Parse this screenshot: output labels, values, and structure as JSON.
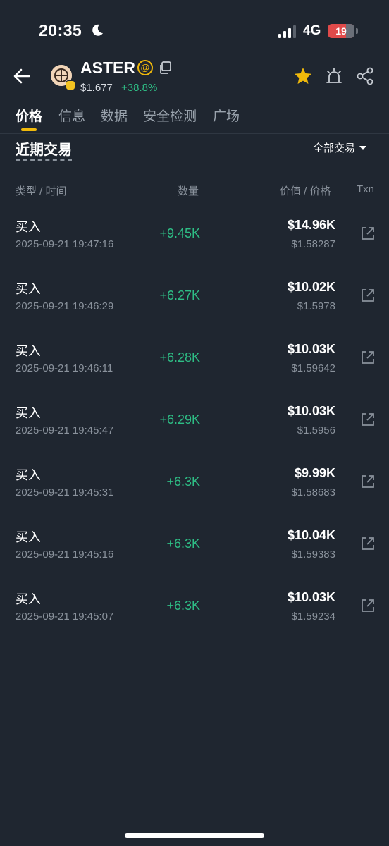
{
  "status_bar": {
    "time": "20:35",
    "network": "4G",
    "battery": "19"
  },
  "header": {
    "token_name": "ASTER",
    "price": "$1.677",
    "change": "+38.8%",
    "icons": [
      "back-icon",
      "at-icon",
      "copy-icon",
      "star-icon",
      "alert-icon",
      "share-icon"
    ],
    "at_symbol": "@"
  },
  "tabs": [
    {
      "label": "价格",
      "active": true
    },
    {
      "label": "信息"
    },
    {
      "label": "数据"
    },
    {
      "label": "安全检测"
    },
    {
      "label": "广场"
    }
  ],
  "section": {
    "title": "近期交易",
    "filter": "全部交易"
  },
  "columns": {
    "type_time": "类型 / 时间",
    "quantity": "数量",
    "value_price": "价值 / 价格",
    "txn": "Txn"
  },
  "trades": [
    {
      "type": "买入",
      "time": "2025-09-21 19:47:16",
      "quantity": "+9.45K",
      "value": "$14.96K",
      "price": "$1.58287"
    },
    {
      "type": "买入",
      "time": "2025-09-21 19:46:29",
      "quantity": "+6.27K",
      "value": "$10.02K",
      "price": "$1.5978"
    },
    {
      "type": "买入",
      "time": "2025-09-21 19:46:11",
      "quantity": "+6.28K",
      "value": "$10.03K",
      "price": "$1.59642"
    },
    {
      "type": "买入",
      "time": "2025-09-21 19:45:47",
      "quantity": "+6.29K",
      "value": "$10.03K",
      "price": "$1.5956"
    },
    {
      "type": "买入",
      "time": "2025-09-21 19:45:31",
      "quantity": "+6.3K",
      "value": "$9.99K",
      "price": "$1.58683"
    },
    {
      "type": "买入",
      "time": "2025-09-21 19:45:16",
      "quantity": "+6.3K",
      "value": "$10.04K",
      "price": "$1.59383"
    },
    {
      "type": "买入",
      "time": "2025-09-21 19:45:07",
      "quantity": "+6.3K",
      "value": "$10.03K",
      "price": "$1.59234"
    }
  ],
  "colors": {
    "background": "#1f2630",
    "accent": "#f0b90b",
    "positive": "#2ebd85",
    "muted": "#8a929c",
    "battery_low": "#e04a4a"
  }
}
